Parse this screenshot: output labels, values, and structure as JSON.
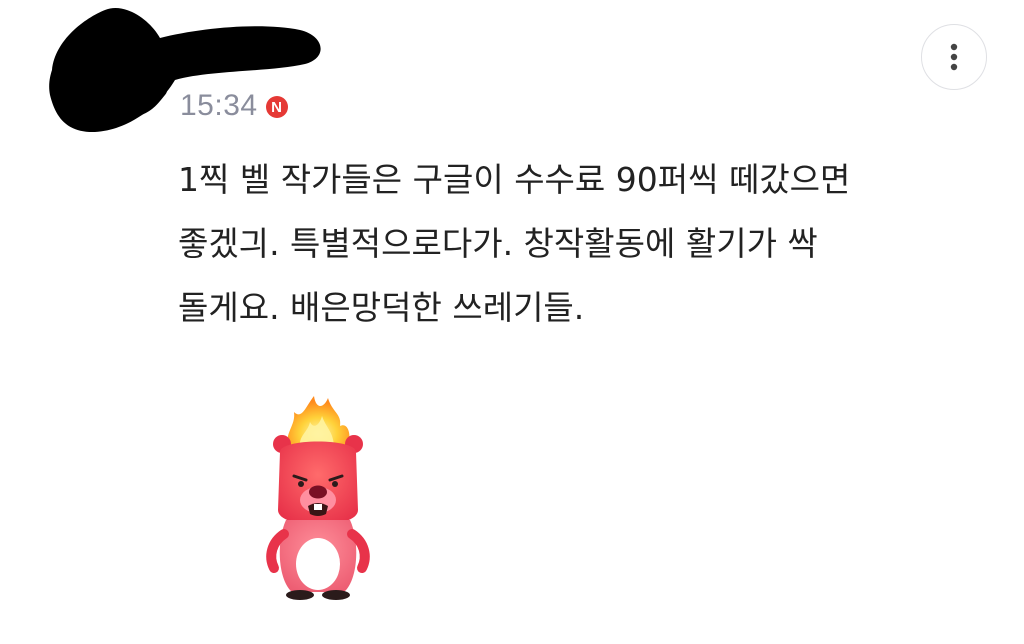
{
  "comment": {
    "timestamp": "15:34",
    "new_badge": "N",
    "lines": [
      "1찍 벨 작가들은 구글이 수수료 90퍼씩 떼갔으면",
      "좋겠긔. 특별적으로다가. 창작활동에 활기가 싹",
      "돌게요. 배은망덕한 쓰레기들."
    ]
  },
  "icons": {
    "more": "more-vertical-icon",
    "sticker": "angry-beaver-sticker"
  },
  "colors": {
    "badge": "#e53935",
    "timestamp": "#8a8d9c",
    "text": "#222222",
    "redaction": "#000000"
  }
}
